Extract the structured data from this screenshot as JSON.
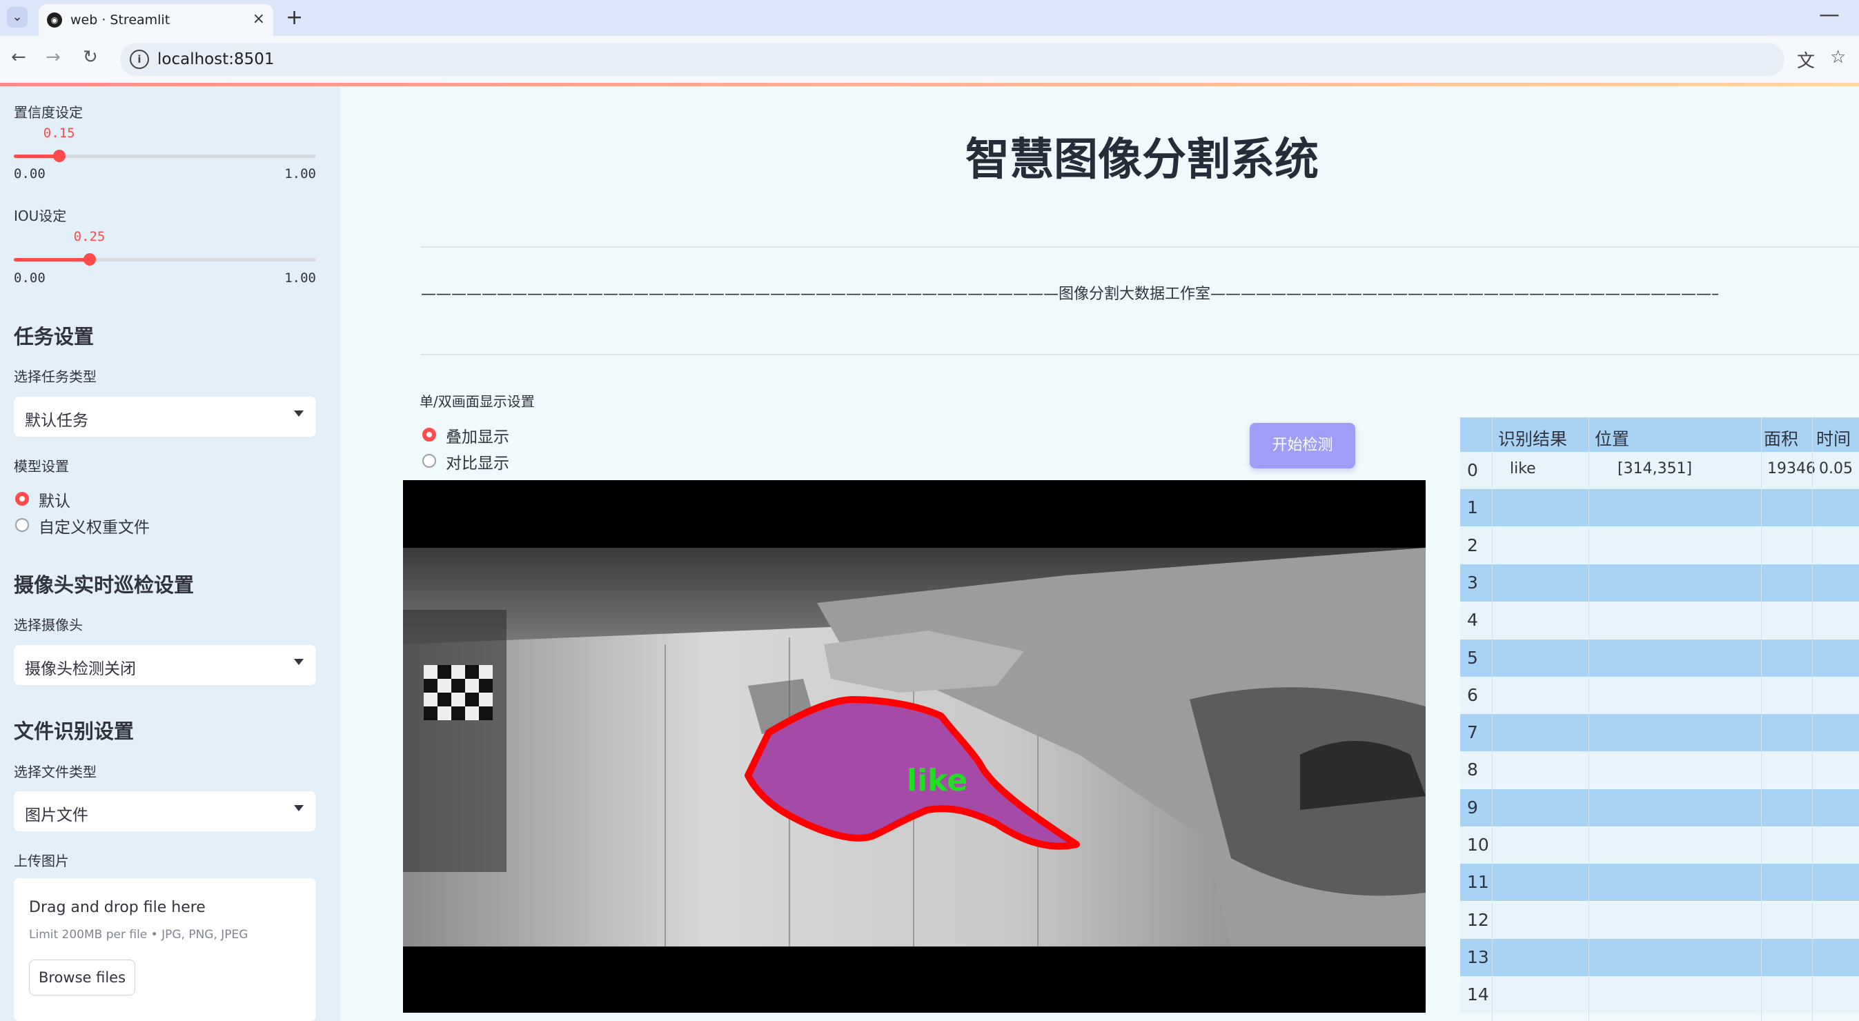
{
  "browser": {
    "tab_title": "web · Streamlit",
    "tab_close": "×",
    "new_tab": "+",
    "minimize": "—",
    "url": "localhost:8501",
    "icons": [
      "tab-menu-icon",
      "streamlit-logo-icon",
      "back-icon",
      "forward-icon",
      "reload-icon",
      "info-icon",
      "translate-icon",
      "star-icon"
    ]
  },
  "sidebar": {
    "confidence": {
      "label": "置信度设定",
      "value": "0.15",
      "value_num": 0.15,
      "min": "0.00",
      "max": "1.00"
    },
    "iou": {
      "label": "IOU设定",
      "value": "0.25",
      "value_num": 0.25,
      "min": "0.00",
      "max": "1.00"
    },
    "task_header": "任务设置",
    "task_type_label": "选择任务类型",
    "task_type_value": "默认任务",
    "model_label": "模型设置",
    "model_options": [
      "默认",
      "自定义权重文件"
    ],
    "camera_header": "摄像头实时巡检设置",
    "camera_label": "选择摄像头",
    "camera_value": "摄像头检测关闭",
    "file_header": "文件识别设置",
    "file_type_label": "选择文件类型",
    "file_type_value": "图片文件",
    "upload_label": "上传图片",
    "uploader": {
      "drop_text": "Drag and drop file here",
      "limit_text": "Limit 200MB per file • JPG, PNG, JPEG",
      "browse_label": "Browse files"
    }
  },
  "main": {
    "title": "智慧图像分割系统",
    "studio_line": "——————————————————————————————————————————图像分割大数据工作室——————————————————————————————————————————",
    "display_mode_label": "单/双画面显示设置",
    "display_options": [
      "叠加显示",
      "对比显示"
    ],
    "start_button": "开始检测",
    "detection_label": "like",
    "accent": "#ff4b4b",
    "mask_color": "#a64aa8",
    "outline_color": "#ff0000",
    "label_color": "#22dd22"
  },
  "results_table": {
    "headers": [
      "识别结果",
      "位置",
      "面积",
      "时间"
    ],
    "rows": [
      {
        "index": "0",
        "result": "like",
        "position": "[314,351]",
        "area": "19346",
        "time": "0.05"
      },
      {
        "index": "1"
      },
      {
        "index": "2"
      },
      {
        "index": "3"
      },
      {
        "index": "4"
      },
      {
        "index": "5"
      },
      {
        "index": "6"
      },
      {
        "index": "7"
      },
      {
        "index": "8"
      },
      {
        "index": "9"
      },
      {
        "index": "10"
      },
      {
        "index": "11"
      },
      {
        "index": "12"
      },
      {
        "index": "13"
      },
      {
        "index": "14"
      }
    ]
  }
}
